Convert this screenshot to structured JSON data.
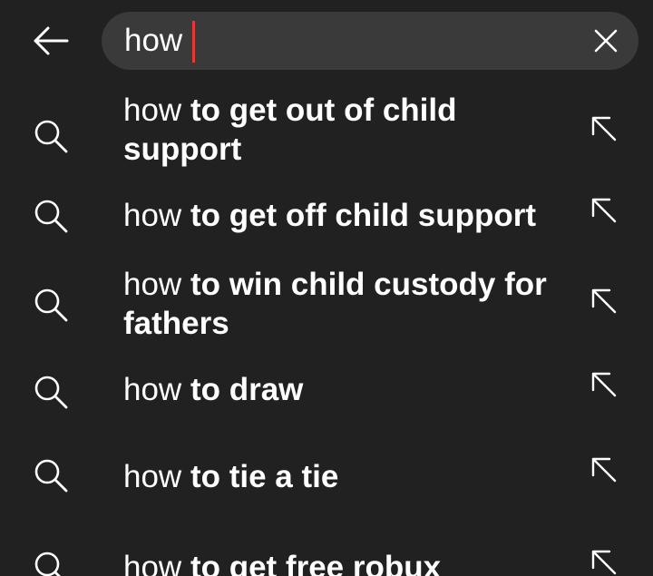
{
  "header": {
    "back_icon": "arrow-left-icon",
    "search": {
      "value": "how",
      "clear_icon": "close-icon"
    }
  },
  "suggestions": [
    {
      "query_prefix": "how",
      "completion": " to get out of child support",
      "icon": "search-icon",
      "fill_icon": "arrow-up-left-icon"
    },
    {
      "query_prefix": "how",
      "completion": " to get off child support",
      "icon": "search-icon",
      "fill_icon": "arrow-up-left-icon"
    },
    {
      "query_prefix": "how",
      "completion": " to win child custody for fathers",
      "icon": "search-icon",
      "fill_icon": "arrow-up-left-icon"
    },
    {
      "query_prefix": "how",
      "completion": " to draw",
      "icon": "search-icon",
      "fill_icon": "arrow-up-left-icon"
    },
    {
      "query_prefix": "how",
      "completion": " to tie a tie",
      "icon": "search-icon",
      "fill_icon": "arrow-up-left-icon"
    },
    {
      "query_prefix": "how",
      "completion": " to get free robux",
      "icon": "search-icon",
      "fill_icon": "arrow-up-left-icon"
    }
  ],
  "colors": {
    "background": "#212121",
    "search_box": "#3a3a3a",
    "caret": "#e53935",
    "text": "#ffffff"
  }
}
